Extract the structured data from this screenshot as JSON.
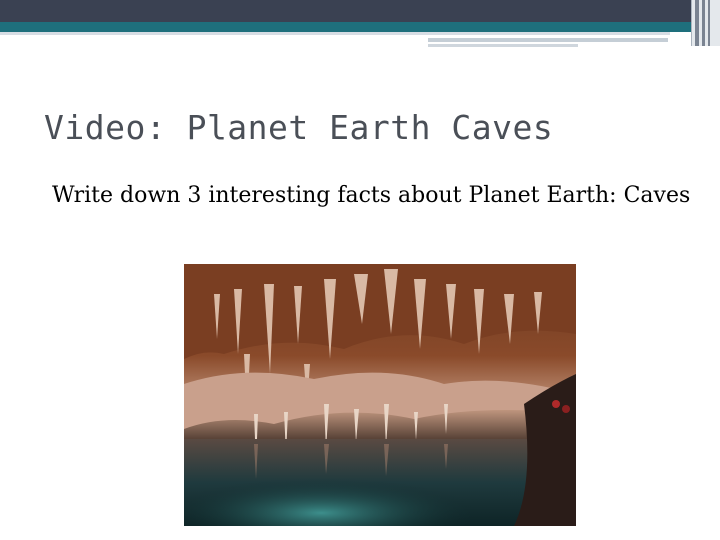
{
  "slide": {
    "title": "Video: Planet Earth Caves",
    "body": "Write down 3 interesting facts about Planet Earth: Caves"
  },
  "colors": {
    "header_dark": "#3a4152",
    "header_teal": "#1e6f7c",
    "title_text": "#4a4f57"
  },
  "image": {
    "icon": "cave-photo"
  }
}
